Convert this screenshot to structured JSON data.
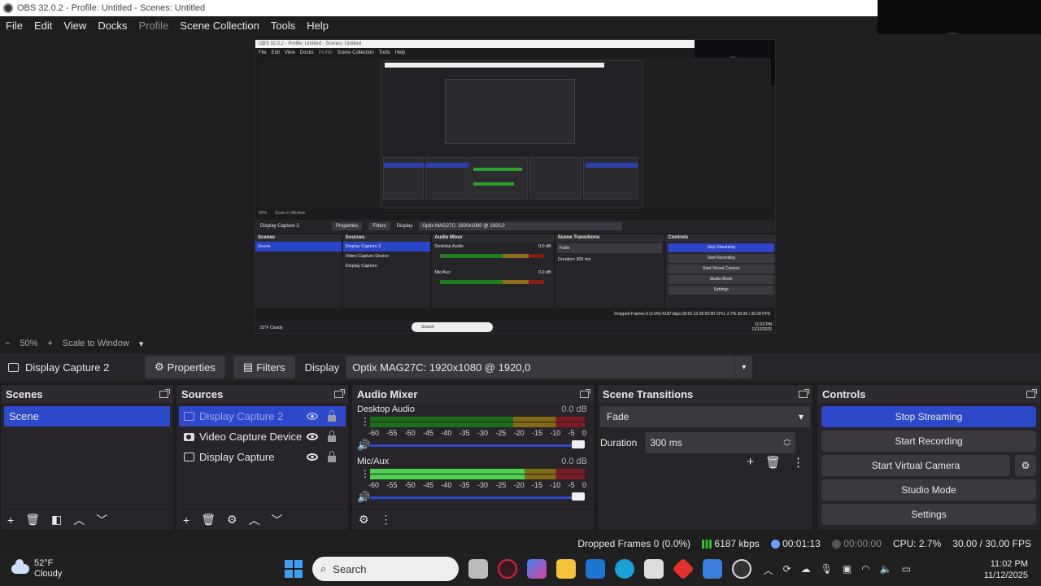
{
  "window": {
    "title": "OBS 32.0.2 - Profile: Untitled - Scenes: Untitled"
  },
  "menu": [
    "File",
    "Edit",
    "View",
    "Docks",
    "Profile",
    "Scene Collection",
    "Tools",
    "Help"
  ],
  "nested": {
    "title": "OBS 32.0.2 - Profile: Untitled - Scenes: Untitled",
    "zoom": "50%",
    "scale_label": "Scale to Window",
    "source": "Display Capture 2",
    "properties": "Properties",
    "filters": "Filters",
    "display": "Display",
    "display_value": "Optix MAG27C: 1920x1080 @ 1920,0",
    "scenes": "Scenes",
    "scene": "Scene",
    "sources": "Sources",
    "src1": "Display Capture 2",
    "src2": "Video Capture Device",
    "src3": "Display Capture",
    "mixer": "Audio Mixer",
    "desktop": "Desktop Audio",
    "mic": "Mic/Aux",
    "db": "0.0 dB",
    "transitions": "Scene Transitions",
    "fade": "Fade",
    "duration": "Duration",
    "duration_value": "300 ms",
    "controls": "Controls",
    "stop": "Stop Streaming",
    "record": "Start Recording",
    "vcam": "Start Virtual Camera",
    "studio": "Studio Mode",
    "settings": "Settings",
    "status": "Dropped Frames 0 (0.0%)   6187 kbps   00:01:13   00:00:00   CPU: 2.7%   30.00 / 30.00 FPS",
    "temp": "52°F",
    "weather": "Cloudy",
    "search": "Search",
    "time": "11:02 PM",
    "date": "11/12/2025"
  },
  "scalebar": {
    "minus": "−",
    "zoom": "50%",
    "plus": "+",
    "scale": "Scale to Window",
    "caret": "▾"
  },
  "propbar": {
    "source_name": "Display Capture 2",
    "properties": "Properties",
    "filters": "Filters",
    "display_label": "Display",
    "display_value": "Optix MAG27C: 1920x1080 @ 1920,0",
    "caret": "▾"
  },
  "scenes": {
    "title": "Scenes",
    "items": [
      "Scene"
    ]
  },
  "sources": {
    "title": "Sources",
    "items": [
      "Display Capture 2",
      "Video Capture Device",
      "Display Capture"
    ]
  },
  "mixer": {
    "title": "Audio Mixer",
    "channels": [
      {
        "name": "Desktop Audio",
        "db": "0.0 dB",
        "level": 0
      },
      {
        "name": "Mic/Aux",
        "db": "0.0 dB",
        "level": 0.72
      }
    ],
    "ticks": [
      "-60",
      "-55",
      "-50",
      "-45",
      "-40",
      "-35",
      "-30",
      "-25",
      "-20",
      "-15",
      "-10",
      "-5",
      "0"
    ]
  },
  "transitions": {
    "title": "Scene Transitions",
    "type": "Fade",
    "duration_label": "Duration",
    "duration_value": "300 ms"
  },
  "controls": {
    "title": "Controls",
    "stop_streaming": "Stop Streaming",
    "start_recording": "Start Recording",
    "start_virtual_camera": "Start Virtual Camera",
    "studio_mode": "Studio Mode",
    "settings": "Settings"
  },
  "status": {
    "dropped": "Dropped Frames 0 (0.0%)",
    "bitrate": "6187 kbps",
    "stream_time": "00:01:13",
    "rec_time": "00:00:00",
    "cpu": "CPU: 2.7%",
    "fps": "30.00 / 30.00 FPS"
  },
  "taskbar": {
    "temp": "52°F",
    "weather": "Cloudy",
    "search": "Search",
    "time": "11:02 PM",
    "date": "11/12/2025"
  },
  "colors": {
    "accent": "#2d48c8",
    "bg": "#1f1e1f",
    "panel": "#272529",
    "meter_green": "#4bd44b"
  }
}
